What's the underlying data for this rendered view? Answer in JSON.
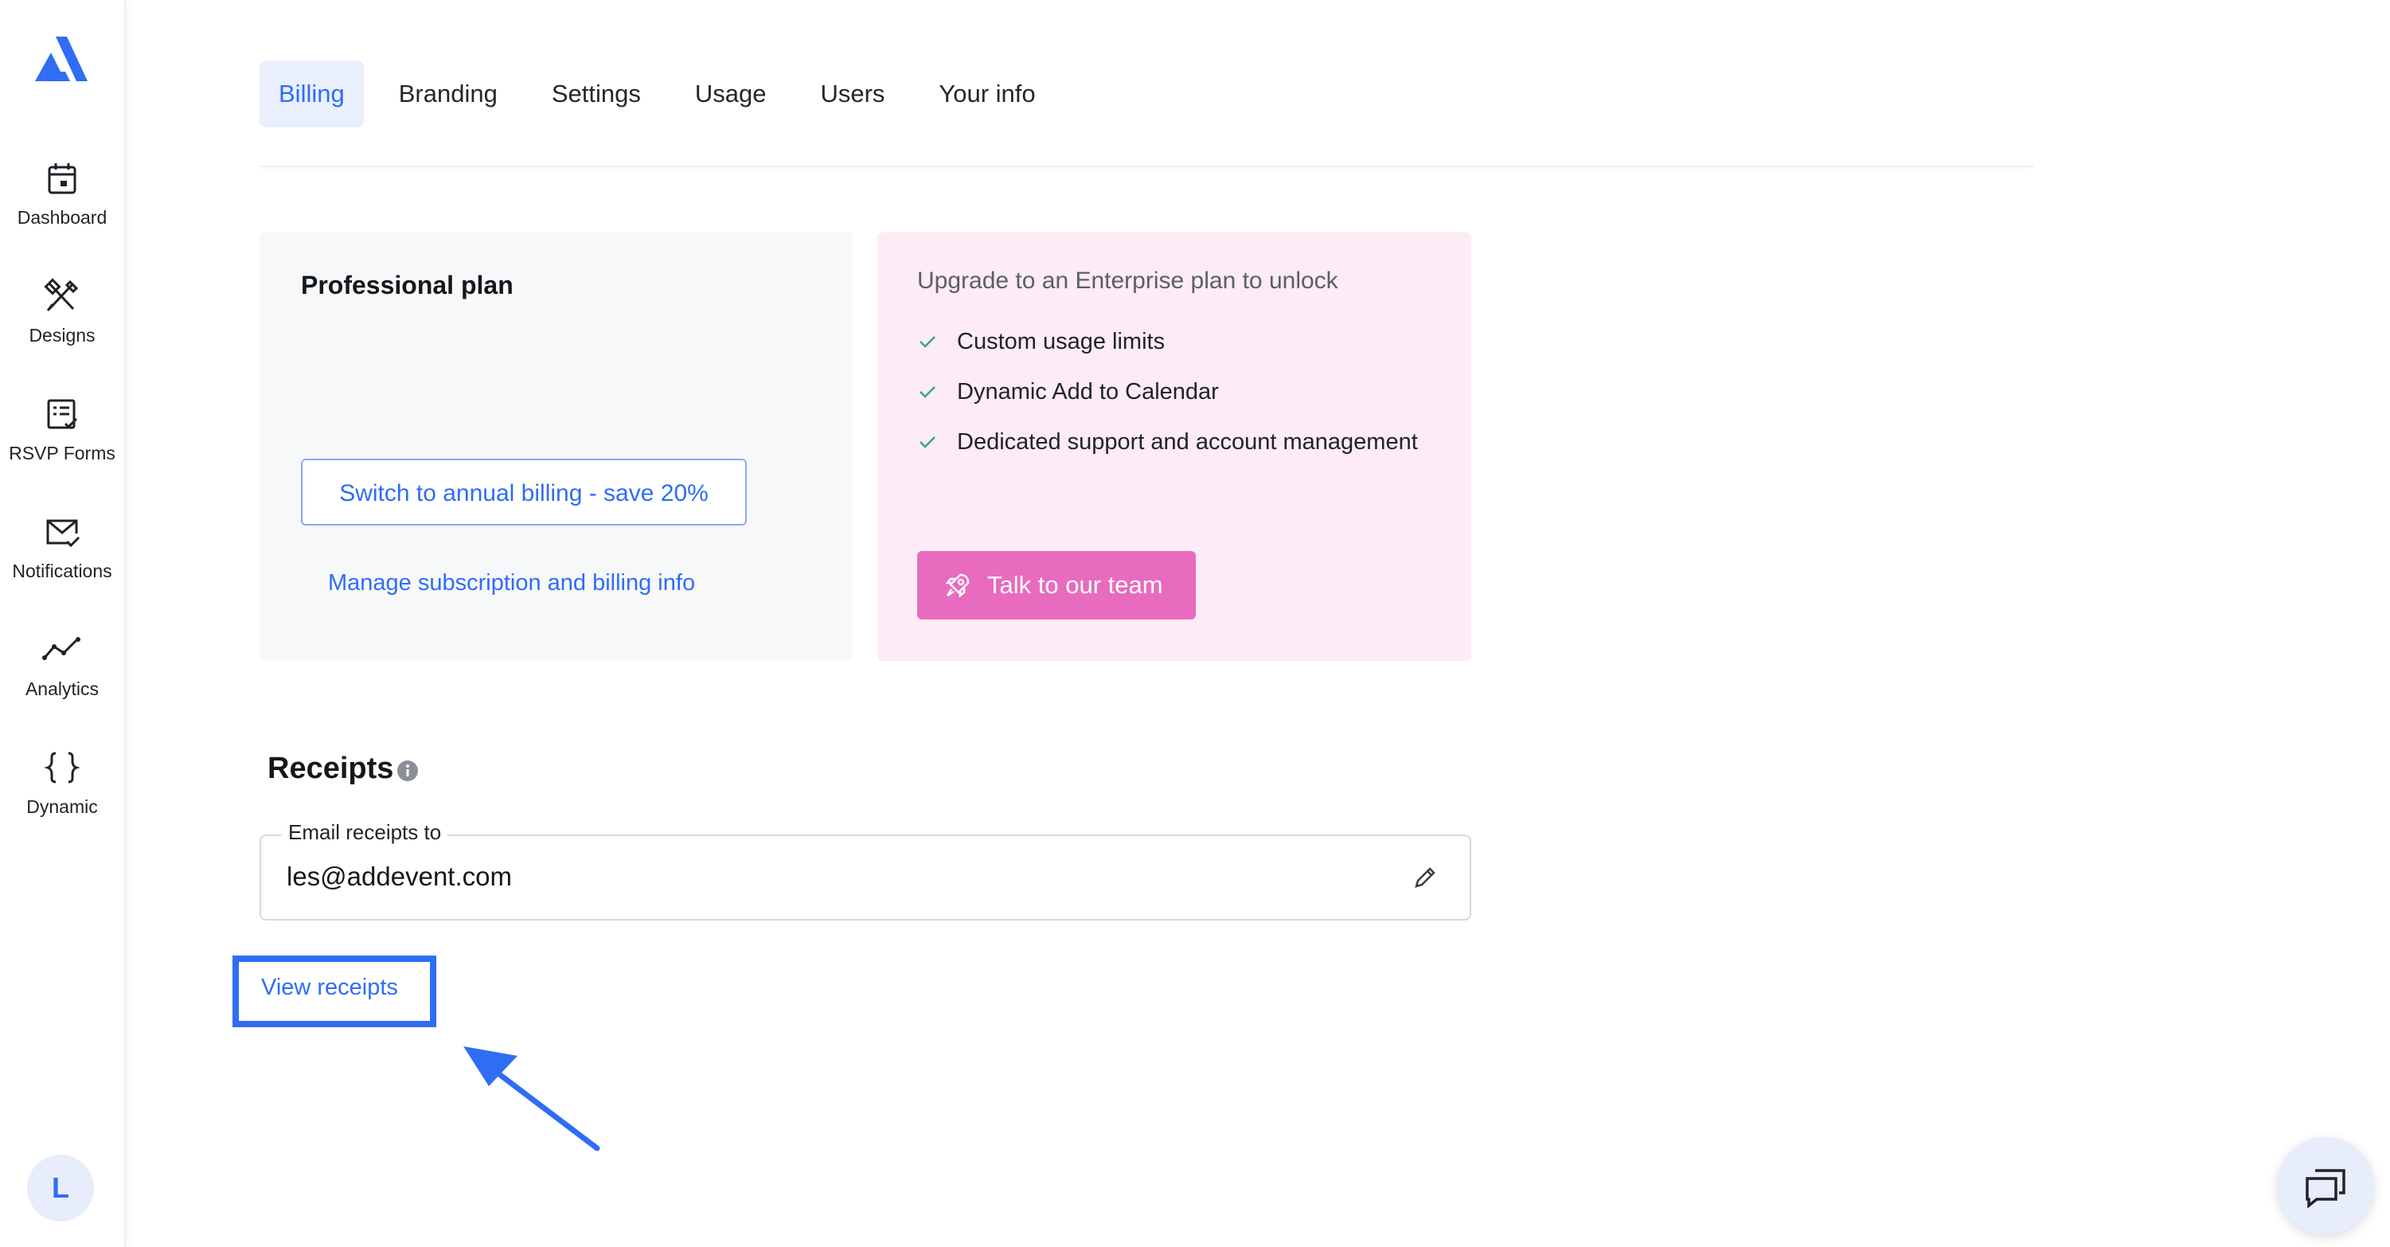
{
  "sidebar": {
    "logo": "addevent-logo",
    "items": [
      {
        "label": "Dashboard",
        "icon": "calendar-icon"
      },
      {
        "label": "Designs",
        "icon": "design-tools-icon"
      },
      {
        "label": "RSVP Forms",
        "icon": "form-checklist-icon"
      },
      {
        "label": "Notifications",
        "icon": "envelope-check-icon"
      },
      {
        "label": "Analytics",
        "icon": "trend-line-icon"
      },
      {
        "label": "Dynamic",
        "icon": "curly-braces-icon"
      }
    ],
    "avatar_initial": "L"
  },
  "tabs": [
    {
      "label": "Billing",
      "active": true
    },
    {
      "label": "Branding",
      "active": false
    },
    {
      "label": "Settings",
      "active": false
    },
    {
      "label": "Usage",
      "active": false
    },
    {
      "label": "Users",
      "active": false
    },
    {
      "label": "Your info",
      "active": false
    }
  ],
  "plan": {
    "title": "Professional plan",
    "annual_button": "Switch to annual billing - save 20%",
    "manage_link": "Manage subscription and billing info"
  },
  "upgrade": {
    "title": "Upgrade to an Enterprise plan to unlock",
    "features": [
      "Custom usage limits",
      "Dynamic Add to Calendar",
      "Dedicated support and account management"
    ],
    "cta": "Talk to our team",
    "cta_icon": "rocket-icon"
  },
  "receipts": {
    "heading": "Receipts",
    "email_label": "Email receipts to",
    "email_value": "les@addevent.com",
    "view_link": "View receipts"
  },
  "colors": {
    "accent": "#2f6df5",
    "cta_pink": "#e86bbf",
    "upgrade_bg": "#fdebf5",
    "plan_bg": "#f7f8fa",
    "check_green": "#3aa77a"
  }
}
